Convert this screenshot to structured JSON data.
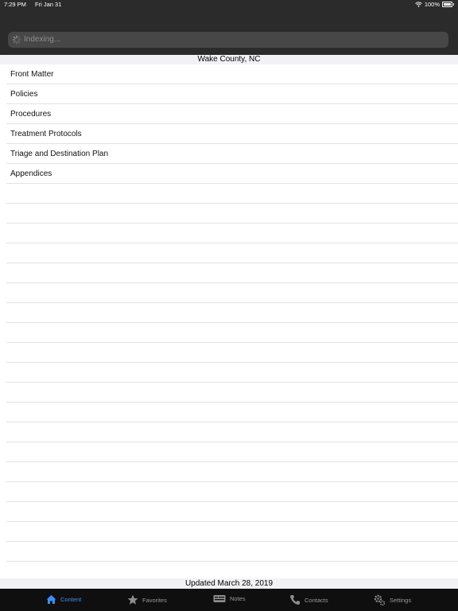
{
  "status": {
    "time": "7:29 PM",
    "date": "Fri Jan 31",
    "battery": "100%"
  },
  "search": {
    "text": "Indexing..."
  },
  "section": {
    "title": "Wake County, NC"
  },
  "list": {
    "items": [
      "Front Matter",
      "Policies",
      "Procedures",
      "Treatment Protocols",
      "Triage and Destination Plan",
      "Appendices"
    ],
    "empty_rows": 20
  },
  "footer": {
    "text": "Updated March 28, 2019"
  },
  "tabs": {
    "content": "Content",
    "favorites": "Favorites",
    "notes": "Notes",
    "contacts": "Contacts",
    "settings": "Settings"
  },
  "colors": {
    "active_tab": "#3a8ef5",
    "bar_bg": "#2b2b2b"
  }
}
